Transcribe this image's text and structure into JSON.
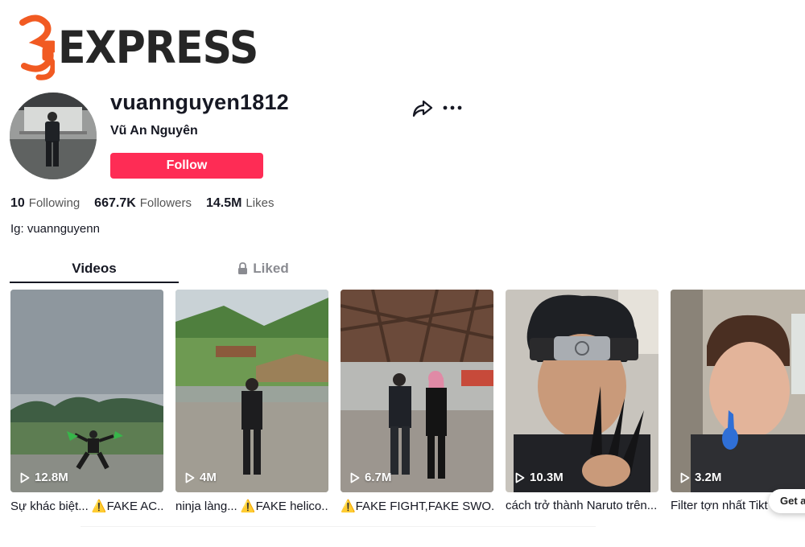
{
  "site": {
    "logo_text": "EXPRESS",
    "logo_digits": "35",
    "accent": "#f15a22"
  },
  "profile": {
    "username": "vuannguyen1812",
    "nickname": "Vũ An Nguyên",
    "follow_label": "Follow",
    "following_count": "10",
    "following_label": "Following",
    "followers_count": "667.7K",
    "followers_label": "Followers",
    "likes_count": "14.5M",
    "likes_label": "Likes",
    "bio": "Ig: vuannguyenn"
  },
  "icons": {
    "share": "share-arrow-icon",
    "more": "ellipsis-icon",
    "lock": "lock-icon",
    "play": "play-icon"
  },
  "tabs": [
    {
      "label": "Videos",
      "active": true
    },
    {
      "label": "Liked",
      "active": false
    }
  ],
  "videos": [
    {
      "views": "12.8M",
      "caption": "Sự khác biệt... ⚠️FAKE AC..."
    },
    {
      "views": "4M",
      "caption": "ninja làng... ⚠️FAKE helico..."
    },
    {
      "views": "6.7M",
      "caption": "⚠️FAKE FIGHT,FAKE SWO..."
    },
    {
      "views": "10.3M",
      "caption": "cách trở thành Naruto trên..."
    },
    {
      "views": "3.2M",
      "caption": "Filter tợn nhất Tikt"
    }
  ],
  "get_app_label": "Get a",
  "colors": {
    "brand": "#fe2c55",
    "text": "#161823",
    "muted": "#8a8b91"
  }
}
